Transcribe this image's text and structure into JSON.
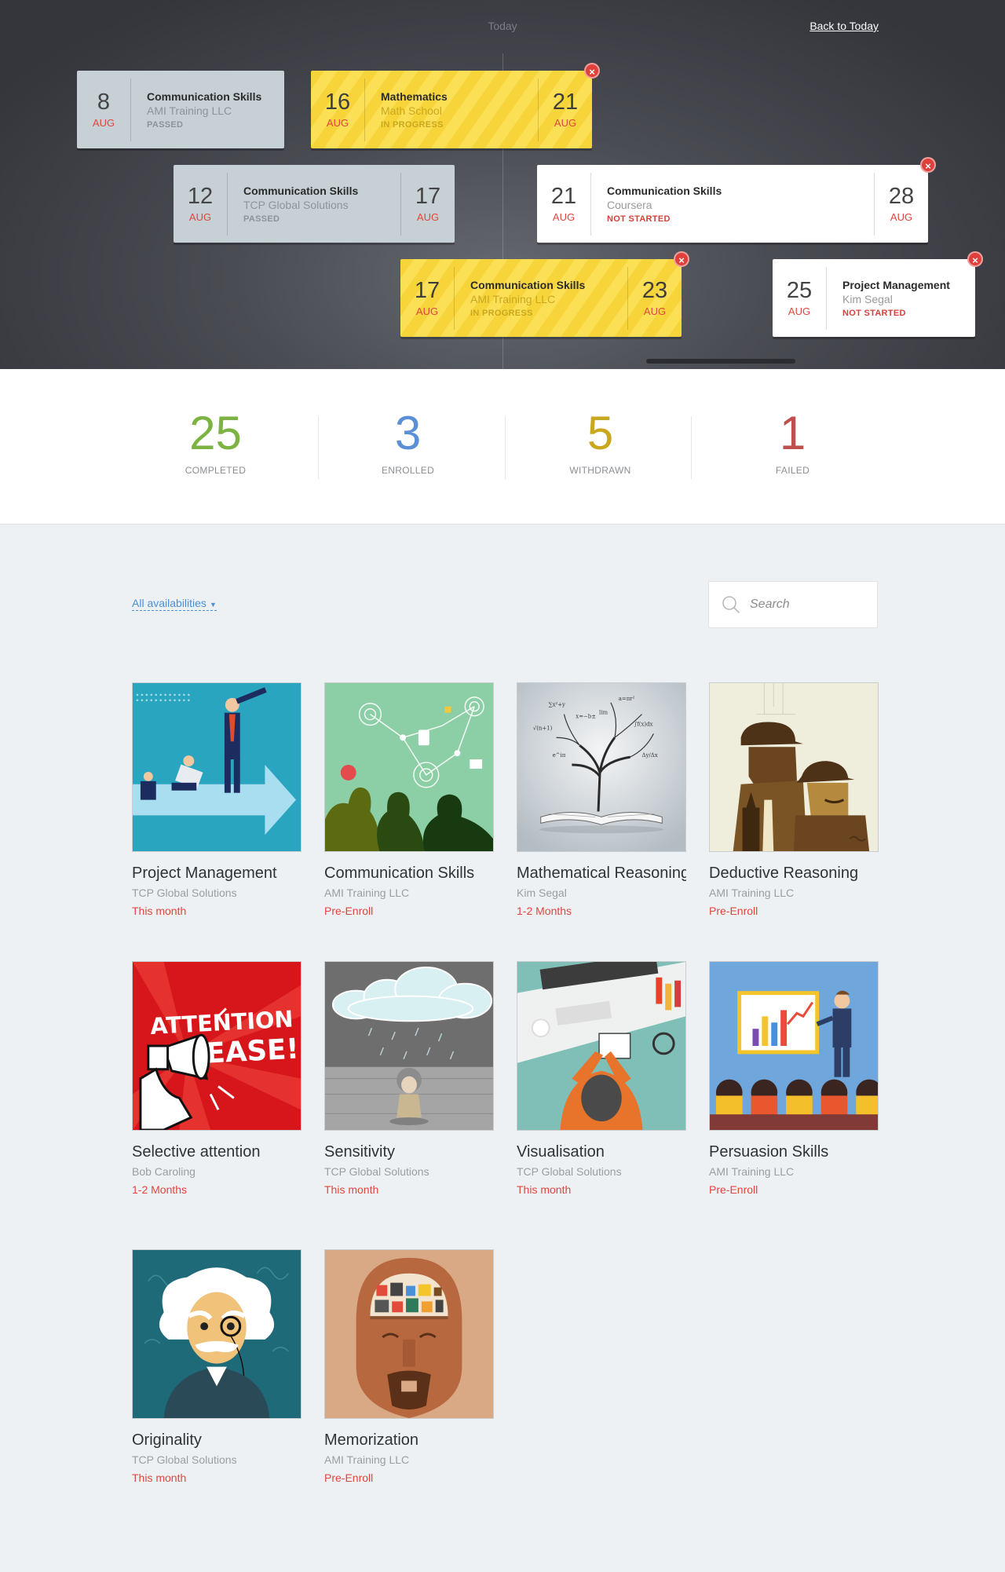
{
  "timeline": {
    "today_label": "Today",
    "back_to_today": "Back to Today",
    "cards": [
      {
        "start_day": "8",
        "start_month": "AUG",
        "title": "Communication Skills",
        "provider": "AMI Training LLC",
        "status": "PASSED"
      },
      {
        "start_day": "16",
        "start_month": "AUG",
        "end_day": "21",
        "end_month": "AUG",
        "title": "Mathematics",
        "provider": "Math School",
        "status": "IN PROGRESS",
        "close": "×"
      },
      {
        "start_day": "12",
        "start_month": "AUG",
        "end_day": "17",
        "end_month": "AUG",
        "title": "Communication Skills",
        "provider": "TCP Global Solutions",
        "status": "PASSED"
      },
      {
        "start_day": "21",
        "start_month": "AUG",
        "end_day": "28",
        "end_month": "AUG",
        "title": "Communication Skills",
        "provider": "Coursera",
        "status": "NOT STARTED",
        "close": "×"
      },
      {
        "start_day": "17",
        "start_month": "AUG",
        "end_day": "23",
        "end_month": "AUG",
        "title": "Communication Skills",
        "provider": "AMI Training LLC",
        "status": "IN PROGRESS",
        "close": "×"
      },
      {
        "start_day": "25",
        "start_month": "AUG",
        "title": "Project Management",
        "provider": "Kim Segal",
        "status": "NOT STARTED",
        "close": "×"
      }
    ]
  },
  "stats": [
    {
      "value": "25",
      "label": "COMPLETED",
      "color": "#7cb342"
    },
    {
      "value": "3",
      "label": "ENROLLED",
      "color": "#5b8fd6"
    },
    {
      "value": "5",
      "label": "WITHDRAWN",
      "color": "#c9a820"
    },
    {
      "value": "1",
      "label": "FAILED",
      "color": "#c0504d"
    }
  ],
  "filter": {
    "label": "All availabilities"
  },
  "search": {
    "placeholder": "Search"
  },
  "courses": [
    {
      "title": "Project Management",
      "provider": "TCP Global Solutions",
      "availability": "This month",
      "image": "businessman-telescope"
    },
    {
      "title": "Communication Skills",
      "provider": "AMI Training LLC",
      "availability": "Pre-Enroll",
      "image": "people-talking-network"
    },
    {
      "title": "Mathematical Reasoning",
      "provider": "Kim Segal",
      "availability": "1-2 Months",
      "image": "book-formula-tree"
    },
    {
      "title": "Deductive Reasoning",
      "provider": "AMI Training LLC",
      "availability": "Pre-Enroll",
      "image": "detectives-silhouette"
    },
    {
      "title": "Selective attention",
      "provider": "Bob Caroling",
      "availability": "1-2 Months",
      "image": "megaphone-attention"
    },
    {
      "title": "Sensitivity",
      "provider": "TCP Global Solutions",
      "availability": "This month",
      "image": "rain-cloud-girl"
    },
    {
      "title": "Visualisation",
      "provider": "TCP Global Solutions",
      "availability": "This month",
      "image": "desk-top-view"
    },
    {
      "title": "Persuasion Skills",
      "provider": "AMI Training LLC",
      "availability": "Pre-Enroll",
      "image": "presenter-chart"
    },
    {
      "title": "Originality",
      "provider": "TCP Global Solutions",
      "availability": "This month",
      "image": "einstein-portrait"
    },
    {
      "title": "Memorization",
      "provider": "AMI Training LLC",
      "availability": "Pre-Enroll",
      "image": "head-shelves"
    }
  ],
  "thumb_text": {
    "attention_1": "ATTENTION",
    "attention_2": "PLEASE!"
  }
}
